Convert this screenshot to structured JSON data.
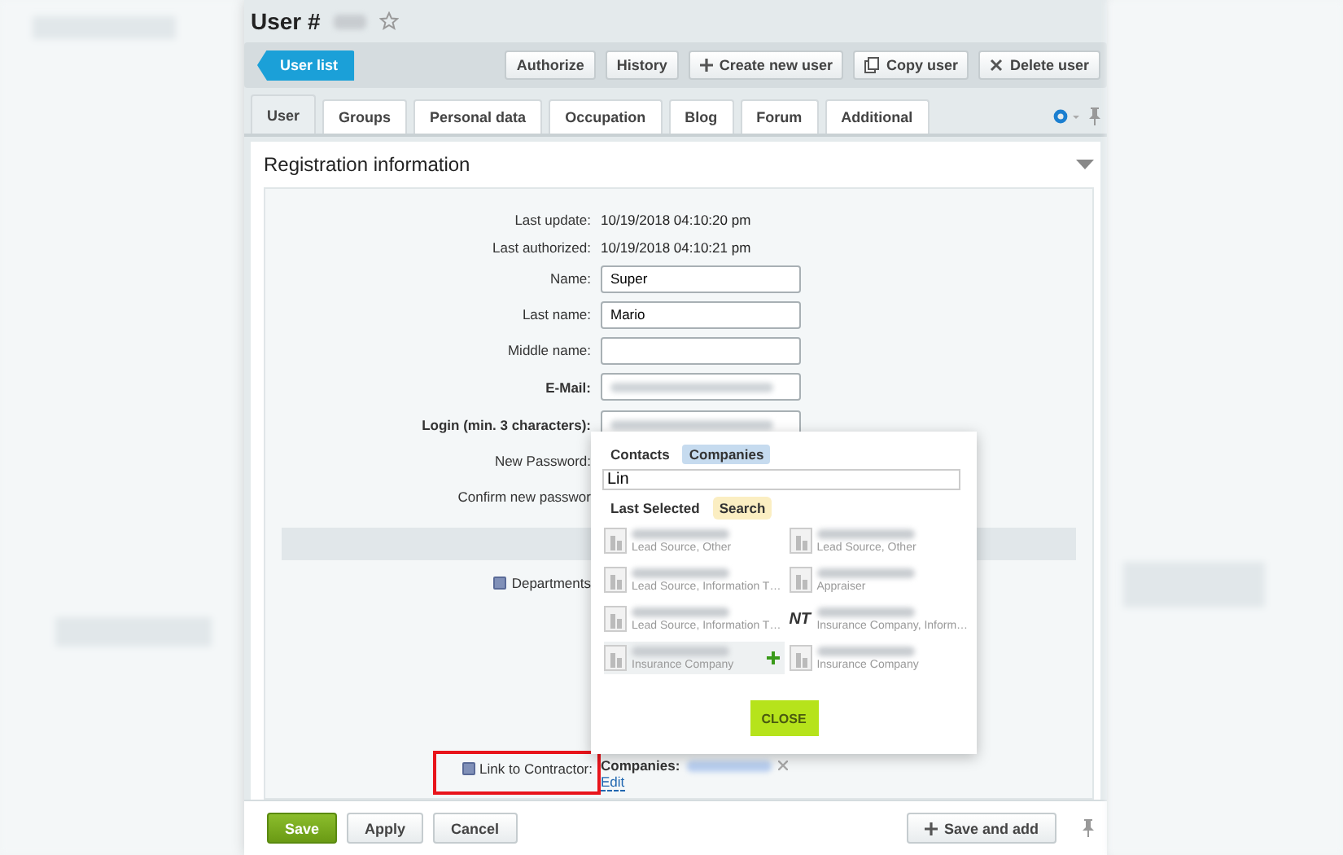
{
  "header": {
    "title": "User #"
  },
  "toolbar": {
    "back": "User list",
    "buttons": [
      {
        "label": "Authorize",
        "kind": "plain"
      },
      {
        "label": "History",
        "kind": "plain"
      },
      {
        "label": "Create new user",
        "kind": "plus"
      },
      {
        "label": "Copy user",
        "kind": "copy"
      },
      {
        "label": "Delete user",
        "kind": "cross"
      }
    ]
  },
  "tabs": [
    {
      "label": "User",
      "selected": true
    },
    {
      "label": "Groups",
      "selected": false
    },
    {
      "label": "Personal data",
      "selected": false
    },
    {
      "label": "Occupation",
      "selected": false
    },
    {
      "label": "Blog",
      "selected": false
    },
    {
      "label": "Forum",
      "selected": false
    },
    {
      "label": "Additional",
      "selected": false
    }
  ],
  "section": {
    "title": "Registration information"
  },
  "fields": [
    {
      "kind": "info",
      "label": "Last update:",
      "value": "10/19/2018 04:10:20 pm"
    },
    {
      "kind": "info",
      "label": "Last authorized:",
      "value": "10/19/2018 04:10:21 pm"
    },
    {
      "kind": "input",
      "label": "Name:",
      "value": "Super"
    },
    {
      "kind": "input",
      "label": "Last name:",
      "value": "Mario"
    },
    {
      "kind": "input",
      "label": "Middle name:"
    },
    {
      "kind": "blurred",
      "label": "E-Mail:",
      "bold": true
    },
    {
      "kind": "blurred",
      "label": "Login (min. 3 characters):",
      "bold": true
    },
    {
      "kind": "covered",
      "label": "New Password:"
    },
    {
      "kind": "covered",
      "label": "Confirm new passwor"
    },
    {
      "kind": "bar"
    },
    {
      "kind": "help",
      "label": "Departments"
    }
  ],
  "popup": {
    "tabs": [
      {
        "label": "Contacts",
        "selected": false
      },
      {
        "label": "Companies",
        "selected": true
      }
    ],
    "search": {
      "value": "Lin"
    },
    "subtabs": [
      {
        "label": "Last Selected",
        "selected": false
      },
      {
        "label": "Search",
        "selected": true
      }
    ],
    "items": [
      {
        "subtitle": "Lead Source, Other",
        "kind": "building",
        "hovered": false
      },
      {
        "subtitle": "Lead Source, Other",
        "kind": "building",
        "hovered": false
      },
      {
        "subtitle": "Lead Source, Information T…",
        "kind": "building",
        "hovered": false
      },
      {
        "subtitle": "Appraiser",
        "kind": "building",
        "hovered": false
      },
      {
        "subtitle": "Lead Source, Information T…",
        "kind": "building",
        "hovered": false
      },
      {
        "subtitle": "Insurance Company, Inform…",
        "kind": "logo",
        "logo_text": "NT",
        "hovered": false
      },
      {
        "subtitle": "Insurance Company",
        "kind": "building",
        "hovered": true
      },
      {
        "subtitle": "Insurance Company",
        "kind": "building",
        "hovered": false
      }
    ],
    "close": "CLOSE"
  },
  "contractor": {
    "label": "Link to Contractor:",
    "highlighted": true,
    "companies_label": "Companies:",
    "edit": "Edit"
  },
  "footer": {
    "buttons": [
      {
        "label": "Save",
        "primary": true
      },
      {
        "label": "Apply",
        "primary": false
      },
      {
        "label": "Cancel",
        "primary": false
      }
    ],
    "save_and_add": "Save and add"
  }
}
